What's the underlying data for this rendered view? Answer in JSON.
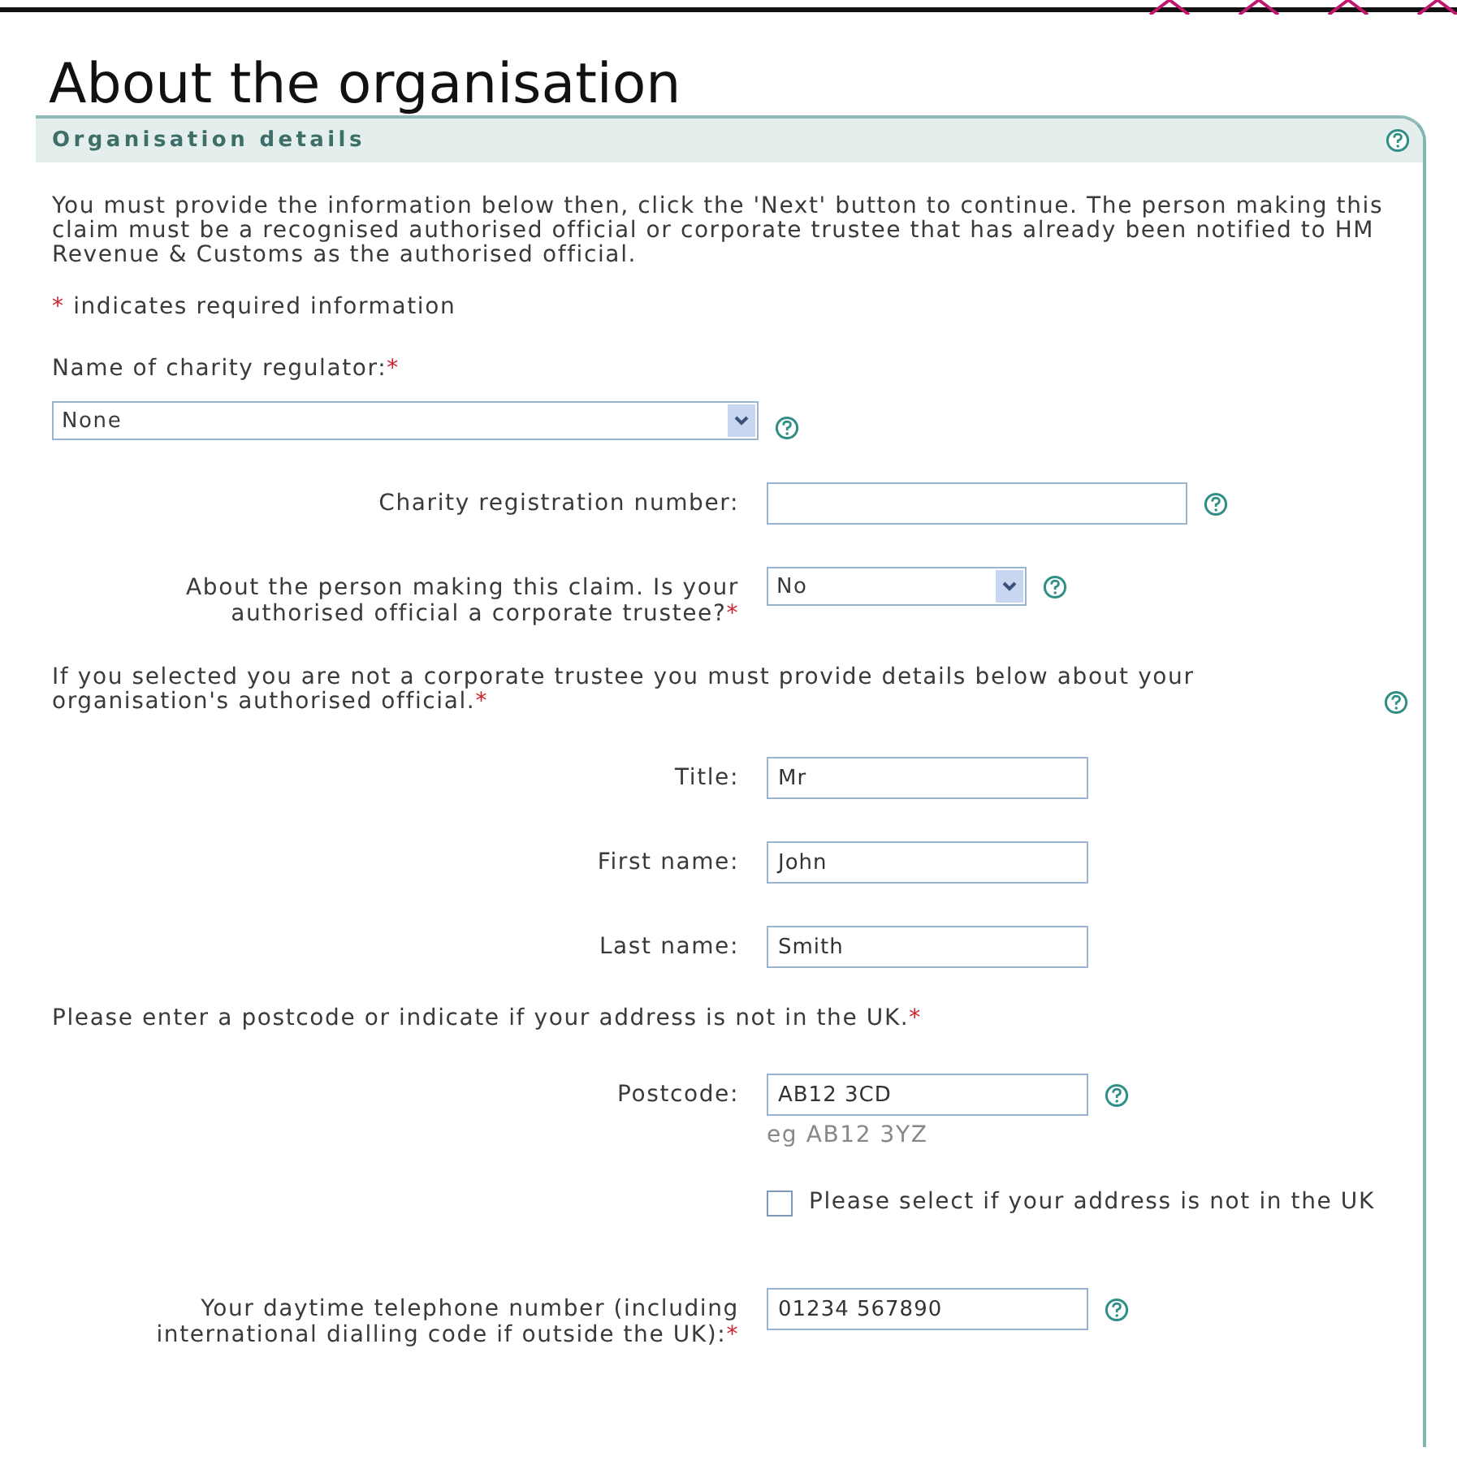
{
  "page_title": "About the organisation",
  "panel": {
    "title": "Organisation details",
    "help": true,
    "intro": "You must provide the information below then, click the 'Next' button to continue. The person making this claim must be a recognised authorised official or corporate trustee that has already been notified to HM Revenue & Customs as the authorised official.",
    "required_note": {
      "marker": "*",
      "text": "indicates required information"
    },
    "rows": [
      {
        "kind": "stacked_select",
        "label": "Name of charity regulator:",
        "required_mark": "*",
        "value": "None",
        "help": true
      },
      {
        "kind": "wide_text",
        "label": "Charity registration number:",
        "help": true
      },
      {
        "kind": "select",
        "label": "About the person making this claim. Is your authorised official a corporate trustee?",
        "required_mark": "*",
        "value": "No",
        "help": true
      },
      {
        "kind": "note",
        "text": "If you selected you are not a corporate trustee you must provide details below about your organisation's authorised official.",
        "required_mark": "*",
        "help": true
      },
      {
        "kind": "text",
        "label": "Title:",
        "value": "Mr",
        "help": false
      },
      {
        "kind": "text",
        "label": "First name:",
        "value": "John",
        "help": false
      },
      {
        "kind": "text",
        "label": "Last name:",
        "value": "Smith",
        "help": false
      },
      {
        "kind": "note",
        "text": "Please enter a postcode or indicate if your address is not in the UK.",
        "required_mark": "*",
        "help": false
      },
      {
        "kind": "text",
        "label": "Postcode:",
        "value": "AB12 3CD",
        "hint": "eg AB12 3YZ",
        "help": true
      },
      {
        "kind": "checkbox",
        "text": "Please select if your address is not in the UK",
        "checked": false
      },
      {
        "kind": "text",
        "label": "Your daytime telephone number (including international dialling code if outside the UK):",
        "required_mark": "*",
        "value": "01234 567890",
        "help": true
      }
    ]
  }
}
